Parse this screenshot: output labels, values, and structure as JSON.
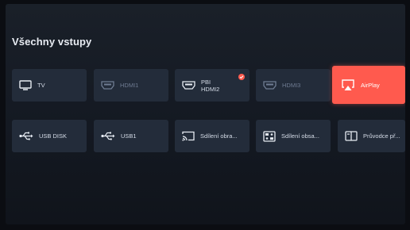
{
  "header": {
    "title": "Všechny vstupy"
  },
  "inputs_row1": [
    {
      "label": "TV",
      "icon": "tv-icon",
      "state": "normal"
    },
    {
      "label": "HDMI1",
      "icon": "hdmi-icon",
      "state": "disabled"
    },
    {
      "label": "PBI\nHDMI2",
      "icon": "hdmi-icon",
      "state": "normal",
      "badge": "check-icon"
    },
    {
      "label": "HDMI3",
      "icon": "hdmi-icon",
      "state": "disabled"
    },
    {
      "label": "AirPlay",
      "icon": "airplay-icon",
      "state": "focused"
    }
  ],
  "inputs_row2": [
    {
      "label": "USB DISK",
      "icon": "usb-icon",
      "state": "normal"
    },
    {
      "label": "USB1",
      "icon": "usb-icon",
      "state": "normal"
    },
    {
      "label": "Sdílení obra...",
      "icon": "cast-icon",
      "state": "normal"
    },
    {
      "label": "Sdílení obsa...",
      "icon": "content-share-icon",
      "state": "normal"
    },
    {
      "label": "Průvodce př...",
      "icon": "guide-book-icon",
      "state": "normal"
    }
  ],
  "colors": {
    "accent": "#ff5a4e",
    "tile": "#232c3a",
    "background": "#141922"
  }
}
